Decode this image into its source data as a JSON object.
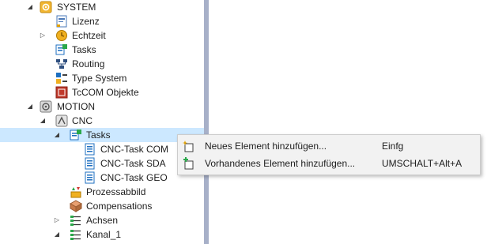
{
  "tree": {
    "items": [
      {
        "label": "SYSTEM",
        "icon": "system-gear-icon",
        "expander": "expanded"
      },
      {
        "label": "Lizenz",
        "icon": "license-icon",
        "expander": "none"
      },
      {
        "label": "Echtzeit",
        "icon": "realtime-icon",
        "expander": "collapsed"
      },
      {
        "label": "Tasks",
        "icon": "tasks-icon",
        "expander": "none"
      },
      {
        "label": "Routing",
        "icon": "routing-icon",
        "expander": "none"
      },
      {
        "label": "Type System",
        "icon": "type-system-icon",
        "expander": "none"
      },
      {
        "label": "TcCOM Objekte",
        "icon": "tccom-icon",
        "expander": "none"
      },
      {
        "label": "MOTION",
        "icon": "motion-icon",
        "expander": "expanded"
      },
      {
        "label": "CNC",
        "icon": "cnc-icon",
        "expander": "expanded"
      },
      {
        "label": "Tasks",
        "icon": "tasks-icon",
        "expander": "expanded",
        "selected": true
      },
      {
        "label": "CNC-Task COM",
        "icon": "task-icon",
        "expander": "none"
      },
      {
        "label": "CNC-Task SDA",
        "icon": "task-icon",
        "expander": "none"
      },
      {
        "label": "CNC-Task GEO",
        "icon": "task-icon",
        "expander": "none"
      },
      {
        "label": "Prozessabbild",
        "icon": "process-image-icon",
        "expander": "none"
      },
      {
        "label": "Compensations",
        "icon": "compensations-icon",
        "expander": "none"
      },
      {
        "label": "Achsen",
        "icon": "axes-icon",
        "expander": "collapsed"
      },
      {
        "label": "Kanal_1",
        "icon": "channel-icon",
        "expander": "expanded"
      }
    ]
  },
  "context_menu": {
    "items": [
      {
        "label": "Neues Element hinzufügen...",
        "shortcut": "Einfg",
        "icon": "new-item-icon"
      },
      {
        "label": "Vorhandenes Element hinzufügen...",
        "shortcut": "UMSCHALT+Alt+A",
        "icon": "existing-item-icon"
      }
    ]
  },
  "colors": {
    "selection": "#cce8ff",
    "splitter": "#a7b0c8",
    "menu_background": "#f2f2f2",
    "task_icon_blue": "#1e6fc0"
  }
}
